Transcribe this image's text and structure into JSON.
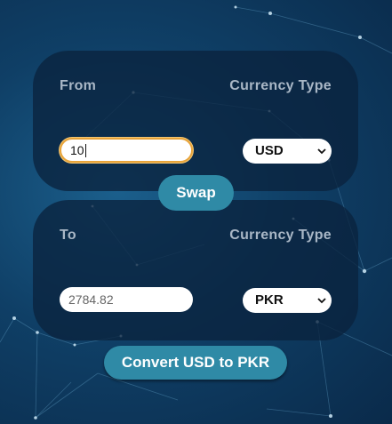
{
  "from_panel": {
    "label": "From",
    "type_label": "Currency Type",
    "amount_value": "10",
    "currency": "USD"
  },
  "swap_button": {
    "label": "Swap"
  },
  "to_panel": {
    "label": "To",
    "type_label": "Currency Type",
    "amount_value": "2784.82",
    "currency": "PKR"
  },
  "convert_button": {
    "label": "Convert USD to PKR"
  },
  "colors": {
    "accent": "#2f8aa6",
    "panel": "#0a233e",
    "focus_ring": "#e8a43a"
  }
}
